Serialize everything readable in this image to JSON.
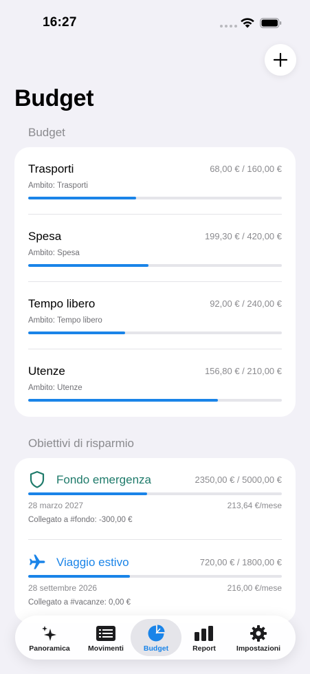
{
  "status_bar": {
    "time": "16:27"
  },
  "page": {
    "title": "Budget"
  },
  "budgets": {
    "header": "Budget",
    "items": [
      {
        "name": "Trasporti",
        "amount": "68,00 € / 160,00 €",
        "scope": "Ambito: Trasporti",
        "progress": 0.425
      },
      {
        "name": "Spesa",
        "amount": "199,30 € / 420,00 €",
        "scope": "Ambito: Spesa",
        "progress": 0.4745
      },
      {
        "name": "Tempo libero",
        "amount": "92,00 € / 240,00 €",
        "scope": "Ambito: Tempo libero",
        "progress": 0.383
      },
      {
        "name": "Utenze",
        "amount": "156,80 € / 210,00 €",
        "scope": "Ambito: Utenze",
        "progress": 0.7467
      }
    ]
  },
  "goals": {
    "header": "Obiettivi di risparmio",
    "items": [
      {
        "name": "Fondo emergenza",
        "icon": "shield-icon",
        "color": "#1e7a6a",
        "amount": "2350,00 € / 5000,00 €",
        "date": "28 marzo 2027",
        "monthly": "213,64 €/mese",
        "link": "Collegato a #fondo: -300,00 €",
        "progress": 0.47
      },
      {
        "name": "Viaggio estivo",
        "icon": "airplane-icon",
        "color": "#1a84e8",
        "amount": "720,00 € / 1800,00 €",
        "date": "28 settembre 2026",
        "monthly": "216,00 €/mese",
        "link": "Collegato a #vacanze: 0,00 €",
        "progress": 0.4
      }
    ]
  },
  "tab_bar": {
    "tabs": [
      {
        "label": "Panoramica",
        "icon": "sparkles-icon",
        "active": false
      },
      {
        "label": "Movimenti",
        "icon": "list-icon",
        "active": false
      },
      {
        "label": "Budget",
        "icon": "pie-chart-icon",
        "active": true
      },
      {
        "label": "Report",
        "icon": "bar-chart-icon",
        "active": false
      },
      {
        "label": "Impostazioni",
        "icon": "gear-icon",
        "active": false
      }
    ]
  },
  "colors": {
    "accent": "#1a84e8",
    "background": "#f2f1f7",
    "progress_track": "#e5e5ea"
  }
}
